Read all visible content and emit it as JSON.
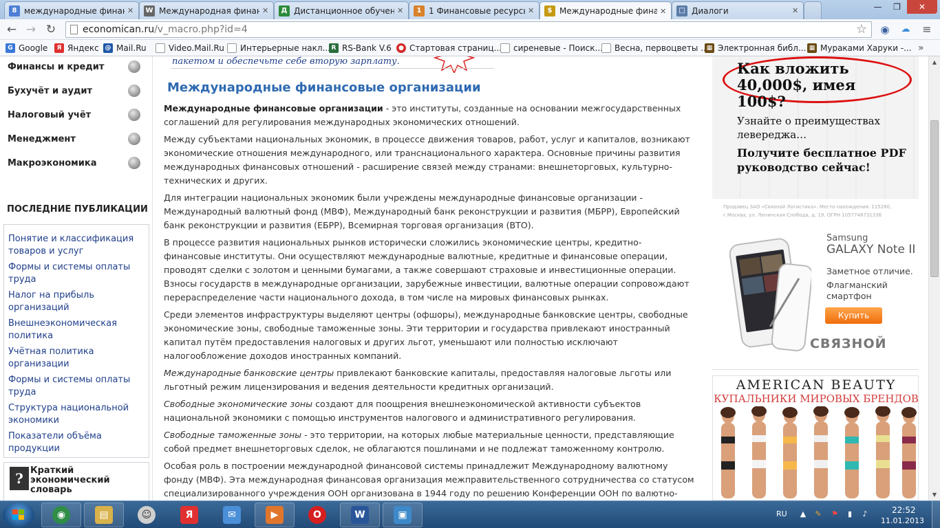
{
  "browser": {
    "tabs": [
      {
        "label": "международные финанс",
        "icon": "search-engine-icon",
        "color": "#4e7fd4",
        "glyph": "8"
      },
      {
        "label": "Международная финанс",
        "icon": "wikipedia-icon",
        "color": "#666666",
        "glyph": "W"
      },
      {
        "label": "Дистанционное обучени",
        "icon": "learning-site-icon",
        "color": "#2c8b3a",
        "glyph": "Д"
      },
      {
        "label": "1 Финансовые ресурсы м",
        "icon": "document-site-icon",
        "color": "#d9822b",
        "glyph": "1"
      },
      {
        "label": "Международные финанс",
        "icon": "economican-site-icon",
        "color": "#c79a13",
        "glyph": "$"
      },
      {
        "label": "Диалоги",
        "icon": "dialogs-site-icon",
        "color": "#5b7ca8",
        "glyph": "□"
      }
    ],
    "url_host": "economican.ru",
    "url_path": "/v_macro.php?id=4",
    "bookmarks": [
      {
        "label": "Google",
        "icon": "google-icon",
        "color": "#3a78d8",
        "glyph": "G"
      },
      {
        "label": "Яндекс",
        "icon": "yandex-icon",
        "color": "#e03030",
        "glyph": "Я"
      },
      {
        "label": "Mail.Ru",
        "icon": "mailru-icon",
        "color": "#1f57a8",
        "glyph": "@"
      },
      {
        "label": "Video.Mail.Ru",
        "icon": "page-icon",
        "color": "#ffffff",
        "glyph": ""
      },
      {
        "label": "Интерьерные накл...",
        "icon": "page-icon",
        "color": "#ffffff",
        "glyph": ""
      },
      {
        "label": "RS-Bank V.6",
        "icon": "rsbank-icon",
        "color": "#2b6d3c",
        "glyph": "R"
      },
      {
        "label": "Стартовая страниц...",
        "icon": "opera-start-icon",
        "color": "#d22a2a",
        "glyph": "●"
      },
      {
        "label": "сиреневые - Поиск...",
        "icon": "page-icon",
        "color": "#ffffff",
        "glyph": ""
      },
      {
        "label": "Весна, первоцветы ...",
        "icon": "page-icon",
        "color": "#ffffff",
        "glyph": ""
      },
      {
        "label": "Электронная библ...",
        "icon": "library-icon",
        "color": "#6b4a12",
        "glyph": "▦"
      },
      {
        "label": "Мураками Харуки -...",
        "icon": "library-icon",
        "color": "#6b4a12",
        "glyph": "▦"
      }
    ]
  },
  "sidebar": {
    "categories": [
      "Финансы и кредит",
      "Бухучёт и аудит",
      "Налоговый учёт",
      "Менеджмент",
      "Макроэкономика"
    ],
    "recent_title": "ПОСЛЕДНИЕ ПУБЛИКАЦИИ",
    "recent": [
      "Понятие и классификация товаров и услуг",
      "Формы и системы оплаты труда",
      "Налог на прибыль организаций",
      "Внешнеэкономическая политика",
      "Учётная политика организации",
      "Формы и системы оплаты труда",
      "Структура национальной экономики",
      "Показатели объёма продукции"
    ],
    "dict_glyph": "?",
    "dict_label": "Краткий экономический словарь"
  },
  "article": {
    "promo_text": "пакетом и обеспечьте себе вторую зарплату.",
    "title": "Международные финансовые организации",
    "p1_bold": "Международные финансовые организации",
    "p1_rest": " - это институты, созданные на основании межгосударственных соглашений для регулирования международных экономических отношений.",
    "p2": "Между субъектами национальных экономик, в процессе движения товаров, работ, услуг и капиталов, возникают экономические отношения международного, или транснационального характера. Основные причины развития международных финансовых отношений - расширение связей между странами: внешнеторговых, культурно-технических и других.",
    "p3": "Для интеграции национальных экономик были учреждены международные финансовые организации - Международный валютный фонд (МВФ), Международный банк реконструкции и развития (МБРР), Европейский банк реконструкции и развития (ЕБРР), Всемирная торговая организация (ВТО).",
    "p4": "В процессе развития национальных рынков исторически сложились экономические центры, кредитно-финансовые институты. Они осуществляют международные валютные, кредитные и финансовые операции, проводят сделки с золотом и ценными бумагами, а также совершают страховые и инвестиционные операции. Взносы государств в международные организации, зарубежные инвестиции, валютные операции сопровождают перераспределение части национального дохода, в том числе на мировых финансовых рынках.",
    "p5": "Среди элементов инфраструктуры выделяют центры (офшоры), международные банковские центры, свободные экономические зоны, свободные таможенные зоны. Эти территории и государства привлекают иностранный капитал путём предоставления налоговых и других льгот, уменьшают или полностью исключают налогообложение доходов иностранных компаний.",
    "p6_italic": "Международные банковские центры",
    "p6_rest": " привлекают банковские капиталы, предоставляя налоговые льготы или льготный режим лицензирования и ведения деятельности кредитных организаций.",
    "p7_italic": "Свободные экономические зоны",
    "p7_rest": " создают для поощрения внешнеэкономической активности субъектов национальной экономики с помощью инструментов налогового и административного регулирования.",
    "p8_italic": "Свободные таможенные зоны",
    "p8_rest": " - это территории, на которых любые материальные ценности, представляющие собой предмет внешнеторговых сделок, не облагаются пошлинами и не подлежат таможенному контролю.",
    "p9": "Особая роль в построении международной финансовой системы принадлежит Международному валютному фонду (МВФ). Эта международная финансовая организация межправительственного сотрудничества со статусом специализированного учреждения ООН организована в 1944 году по решению Конференции ООН по валютно-"
  },
  "ads": {
    "forex_head": "Как вложить 40,000$, имея 100$?",
    "forex_sub": "Узнайте о преимуществах левереджа…",
    "forex_cta": "Получите бесплатное PDF руководство сейчас!",
    "samsung_legal": "Продавец ЗАО «Связной Логистика». Место нахождения: 115280, г.Москва, ул. Ленинская Слобода, д. 19. ОГРН 1057748731336",
    "samsung_brand": "Samsung",
    "samsung_model": "GALAXY Note II",
    "samsung_desc1": "Заметное отличие.",
    "samsung_desc2": "Флагманский смартфон",
    "samsung_buy": "Купить",
    "samsung_logo": "СВЯЗНОЙ",
    "beauty_title": "AMERICAN BEAUTY",
    "beauty_subtitle": "КУПАЛЬНИКИ МИРОВЫХ БРЕНДОВ"
  },
  "taskbar": {
    "items": [
      {
        "icon": "chrome-icon",
        "color": "#2f8d46",
        "glyph": "◉"
      },
      {
        "icon": "file-explorer-icon",
        "color": "#d8b24a",
        "glyph": "▤"
      },
      {
        "icon": "app-icon",
        "color": "#cfcfcf",
        "glyph": "☺"
      },
      {
        "icon": "yandex-browser-icon",
        "color": "#e03030",
        "glyph": "Я"
      },
      {
        "icon": "mail-icon",
        "color": "#4a8fd8",
        "glyph": "✉"
      },
      {
        "icon": "media-player-icon",
        "color": "#e0762b",
        "glyph": "▶"
      },
      {
        "icon": "opera-icon",
        "color": "#d61f1f",
        "glyph": "O"
      },
      {
        "icon": "word-icon",
        "color": "#2a5699",
        "glyph": "W"
      },
      {
        "icon": "picture-viewer-icon",
        "color": "#3d89c9",
        "glyph": "▣"
      }
    ],
    "lang": "RU",
    "time": "22:52",
    "date": "11.01.2013"
  }
}
